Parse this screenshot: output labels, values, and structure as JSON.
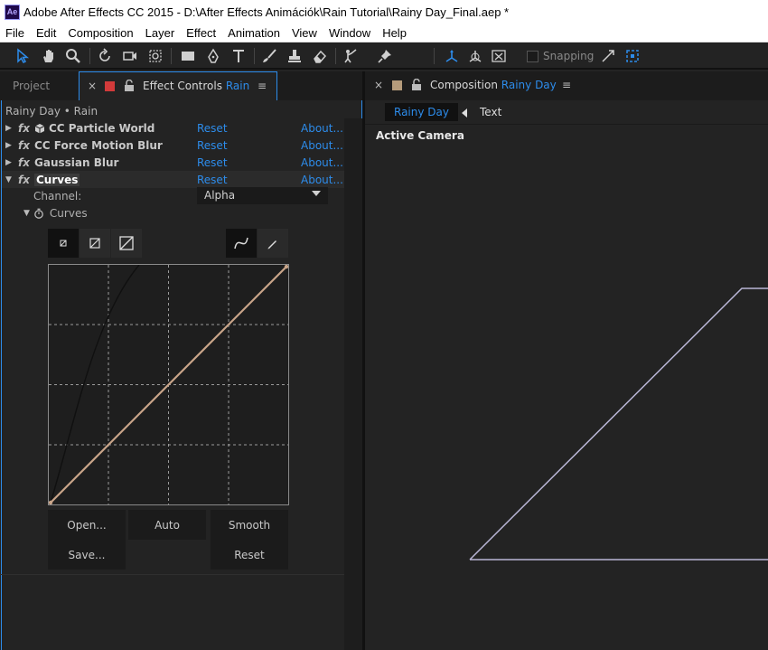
{
  "app": {
    "title": "Adobe After Effects CC 2015 - D:\\After Effects Animációk\\Rain Tutorial\\Rainy Day_Final.aep *",
    "logo_text": "Ae"
  },
  "menu": [
    "File",
    "Edit",
    "Composition",
    "Layer",
    "Effect",
    "Animation",
    "View",
    "Window",
    "Help"
  ],
  "toolbar": {
    "snapping_label": "Snapping"
  },
  "left_panel": {
    "tab_project": "Project",
    "tab_close": "×",
    "tab_effect_prefix": "Effect Controls",
    "tab_effect_layer": "Rain",
    "tab_menu": "≡",
    "breadcrumb": "Rainy Day • Rain",
    "effects": [
      {
        "name": "CC Particle World",
        "reset": "Reset",
        "about": "About..."
      },
      {
        "name": "CC Force Motion Blur",
        "reset": "Reset",
        "about": "About..."
      },
      {
        "name": "Gaussian Blur",
        "reset": "Reset",
        "about": "About..."
      },
      {
        "name": "Curves",
        "reset": "Reset",
        "about": "About..."
      }
    ],
    "channel_label": "Channel:",
    "channel_value": "Alpha",
    "curves_prop_label": "Curves",
    "buttons": {
      "open": "Open...",
      "auto": "Auto",
      "smooth": "Smooth",
      "save": "Save...",
      "reset": "Reset"
    }
  },
  "right_panel": {
    "tab_close": "×",
    "tab_prefix": "Composition",
    "tab_comp": "Rainy Day",
    "tab_menu": "≡",
    "flow_active": "Rainy Day",
    "flow_text": "Text",
    "view_label": "Active Camera"
  },
  "colors": {
    "accent": "#2d8ceb",
    "effect_label": "#d23a3a",
    "comp_label": "#b59b7b",
    "curve_line": "#c9a589"
  }
}
